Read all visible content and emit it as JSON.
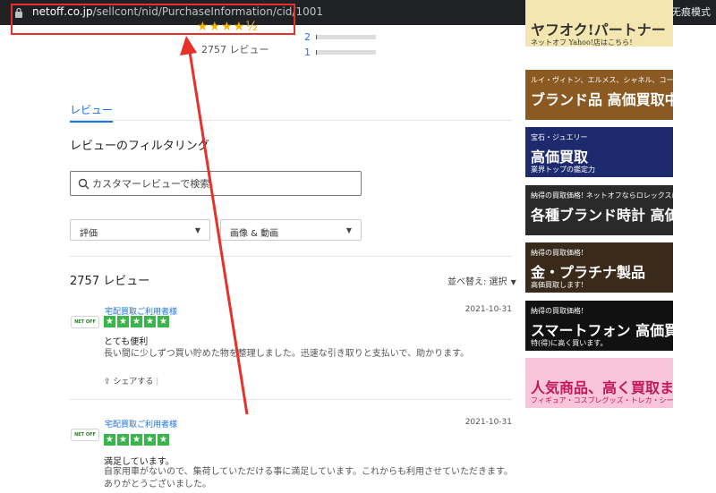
{
  "browser": {
    "url_domain": "netoff.co.jp",
    "url_path": "/sellcont/nid/PurchaseInformation/cid/1001",
    "profile_label": "无痕模式（E"
  },
  "summary": {
    "stars": "★★★★½",
    "review_count": "2757 レビュー",
    "rating_rows": [
      {
        "label": "2",
        "fill": 0.02
      },
      {
        "label": "1",
        "fill": 0.01
      }
    ]
  },
  "tabs": {
    "review": "レビュー"
  },
  "filter": {
    "title": "レビューのフィルタリング",
    "search_placeholder": "カスタマーレビューで検索",
    "rating_dropdown": "評価",
    "media_dropdown": "画像 & 動画"
  },
  "list": {
    "heading": "2757 レビュー",
    "sort_label": "並べ替え: 選択"
  },
  "reviews": [
    {
      "logo": "NET OFF",
      "reviewer": "宅配買取ご利用者様",
      "date": "2021-10-31",
      "title": "とても便利",
      "body": "長い間に少しずつ買い貯めた物を整理しました。迅速な引き取りと支払いで、助かります。",
      "share": "シェアする"
    },
    {
      "logo": "NET OFF",
      "reviewer": "宅配買取ご利用者様",
      "date": "2021-10-31",
      "title": "満足しています。",
      "body": "自家用車がないので、集荷していただける事に満足しています。これからも利用させていただきます。ありがとうございました。",
      "share": ""
    }
  ],
  "sidebar": {
    "banners": [
      {
        "line1": "",
        "line2": "ヤフオク!パートナー",
        "line3": "ネットオフ Yahoo!店はこちら！",
        "bg": "#f4e6b0",
        "fg": "#333333"
      },
      {
        "line1": "ルイ・ヴィトン、エルメス、シャネル、コーチ、グッチ",
        "line2": "ブランド品 高価買取中",
        "line3": "",
        "bg": "#8a5a22",
        "fg": "#ffffff"
      },
      {
        "line1": "宝石・ジュエリー",
        "line2": "高価買取",
        "line3": "業界トップの鑑定力",
        "bg": "#1d2a6e",
        "fg": "#ffffff"
      },
      {
        "line1": "納得の買取価格! ネットオフならロレックスはもちろん",
        "line2": "各種ブランド時計 高価買取中!",
        "line3": "",
        "bg": "#2a2a2a",
        "fg": "#ffffff"
      },
      {
        "line1": "納得の買取価格!",
        "line2": "金・プラチナ製品",
        "line3": "高価買取します!",
        "bg": "#3a2a1a",
        "fg": "#ffffff"
      },
      {
        "line1": "納得の買取価格!",
        "line2": "スマートフォン 高価買取中!",
        "line3": "特(得)に高く買います。",
        "bg": "#111111",
        "fg": "#ffffff"
      },
      {
        "line1": "",
        "line2": "人気商品、高く買取ます!",
        "line3": "フィギュア・コスプレグッズ・トレカ・シール・萌えグッズ",
        "bg": "#f8c6d8",
        "fg": "#c2185b"
      }
    ]
  }
}
